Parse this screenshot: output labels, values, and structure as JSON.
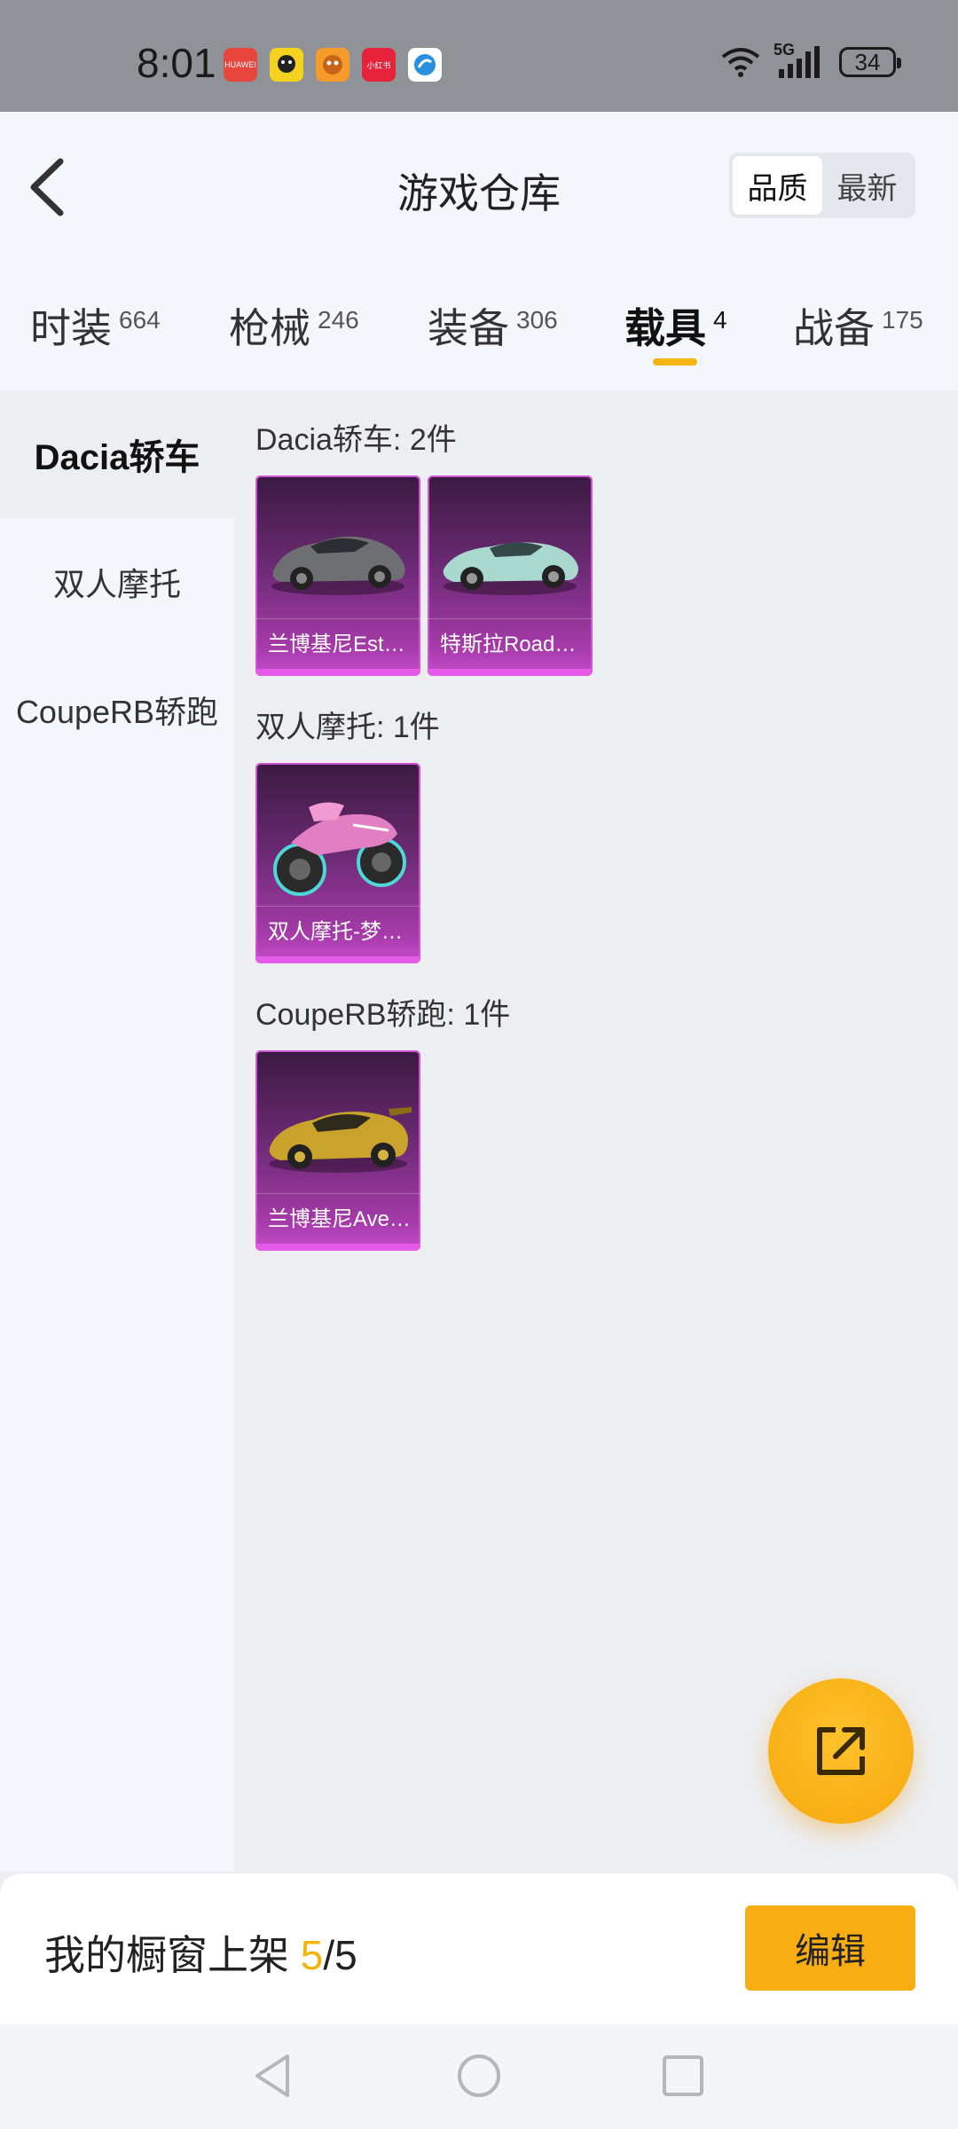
{
  "status_bar": {
    "time": "8:01",
    "network": "5G",
    "battery": "34",
    "app_icons": [
      {
        "name": "huawei-app-icon",
        "color": "#e8453c",
        "text": "HUAWEI"
      },
      {
        "name": "yellow-app-icon",
        "color": "#f4d21f",
        "text": ""
      },
      {
        "name": "orange-app-icon",
        "color": "#f59b2a",
        "text": ""
      },
      {
        "name": "xiaohongshu-app-icon",
        "color": "#e5243b",
        "text": "小红书"
      },
      {
        "name": "blue-app-icon",
        "color": "#ffffff",
        "text": ""
      }
    ]
  },
  "header": {
    "title": "游戏仓库",
    "sort_options": [
      "品质",
      "最新"
    ],
    "active_sort": "品质"
  },
  "tabs": [
    {
      "label": "时装",
      "count": "664"
    },
    {
      "label": "枪械",
      "count": "246"
    },
    {
      "label": "装备",
      "count": "306"
    },
    {
      "label": "载具",
      "count": "4",
      "active": true
    },
    {
      "label": "战备",
      "count": "175"
    }
  ],
  "sidebar": {
    "items": [
      "Dacia轿车",
      "双人摩托",
      "CoupeRB轿跑"
    ],
    "active": "Dacia轿车"
  },
  "sections": [
    {
      "title": "Dacia轿车: 2件",
      "items": [
        {
          "label": "兰博基尼Est…",
          "image": "grey-sports-car"
        },
        {
          "label": "特斯拉Road…",
          "image": "mint-roadster-car"
        }
      ]
    },
    {
      "title": "双人摩托: 1件",
      "items": [
        {
          "label": "双人摩托-梦…",
          "image": "pink-motorcycle"
        }
      ]
    },
    {
      "title": "CoupeRB轿跑: 1件",
      "items": [
        {
          "label": "兰博基尼Ave…",
          "image": "gold-sports-car"
        }
      ]
    }
  ],
  "bottom_bar": {
    "label": "我的橱窗上架",
    "current": "5",
    "total": "/5",
    "edit_label": "编辑"
  },
  "colors": {
    "accent": "#f8ae12",
    "card_purple": "#a43aa8"
  }
}
